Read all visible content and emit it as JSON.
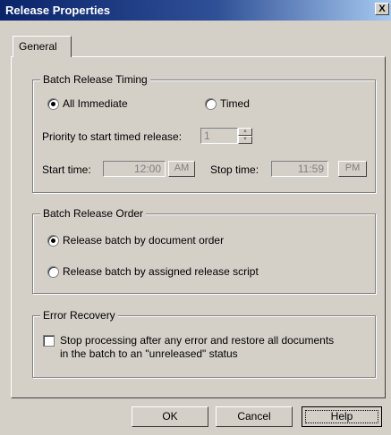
{
  "window": {
    "title": "Release Properties",
    "close_label": "X"
  },
  "tabs": [
    {
      "label": "General",
      "selected": true
    }
  ],
  "timing": {
    "legend": "Batch Release Timing",
    "all_immediate_label": "All Immediate",
    "timed_label": "Timed",
    "selected": "all_immediate",
    "priority_label": "Priority to start timed release:",
    "priority_value": "1",
    "start_label": "Start time:",
    "start_value": "12:00",
    "start_ampm": "AM",
    "stop_label": "Stop time:",
    "stop_value": "11:59",
    "stop_ampm": "PM"
  },
  "order": {
    "legend": "Batch Release Order",
    "by_document_label": "Release batch by document order",
    "by_script_label": "Release batch by assigned release script",
    "selected": "by_document"
  },
  "error_recovery": {
    "legend": "Error Recovery",
    "checked": false,
    "line1": "Stop processing after any error and restore all documents",
    "line2": "in the batch to an \"unreleased\" status"
  },
  "buttons": {
    "ok": "OK",
    "cancel": "Cancel",
    "help": "Help"
  }
}
